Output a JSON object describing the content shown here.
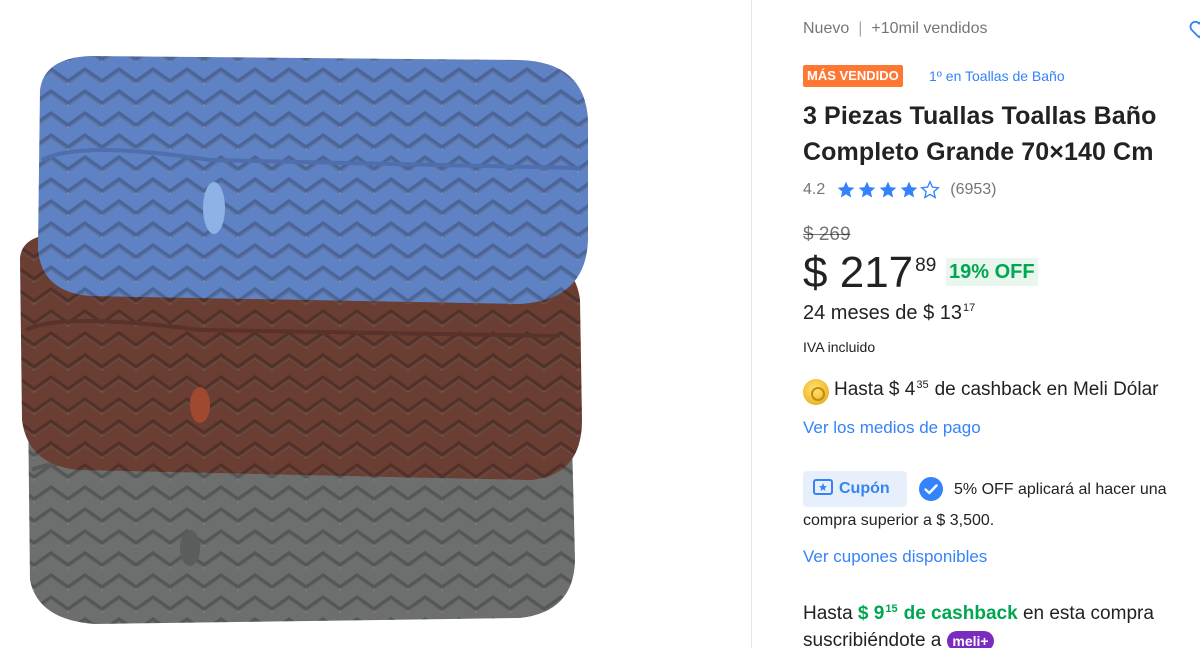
{
  "product": {
    "condition": "Nuevo",
    "sold": "+10mil vendidos",
    "badge": "MÁS VENDIDO",
    "rank": "1º en Toallas de Baño",
    "title": "3 Piezas Tuallas Toallas Baño Completo Grande 70×140 Cm",
    "rating_value": "4.2",
    "rating_stars": 4.2,
    "reviews": "(6953)",
    "original_price": "$ 269",
    "price_currency": "$",
    "price_int": "217",
    "price_cents": "89",
    "discount": "19% OFF",
    "installments_prefix": "24 meses de $ 13",
    "installments_cents": "17",
    "tax_note": "IVA incluido",
    "cashback_prefix": "Hasta $ 4",
    "cashback_cents": "35",
    "cashback_suffix": "de cashback en Meli Dólar",
    "payment_link": "Ver los medios de pago",
    "coupon_label": "Cupón",
    "coupon_text_line1": "5% OFF aplicará al hacer una",
    "coupon_text_line2": "compra superior a $ 3,500.",
    "coupons_link": "Ver cupones disponibles",
    "meli_prefix": "Hasta",
    "meli_amount": "$ 9",
    "meli_cents": "15",
    "meli_bold": "de cashback",
    "meli_suffix": "en esta compra",
    "meli_line2": "suscribiéndote a",
    "meli_badge": "meli+"
  },
  "colors": {
    "accent_blue": "#3483fa",
    "badge_orange": "#ff7733",
    "discount_green": "#00a650",
    "towel_blue": "#5f82c4",
    "towel_brown": "#6a3e33",
    "towel_gray": "#6d6f6e"
  },
  "icons": {
    "favorite": "heart-icon",
    "rating": "star-icon",
    "cashback": "coin-icon",
    "coupon": "ticket-icon",
    "verified": "check-circle-icon"
  }
}
